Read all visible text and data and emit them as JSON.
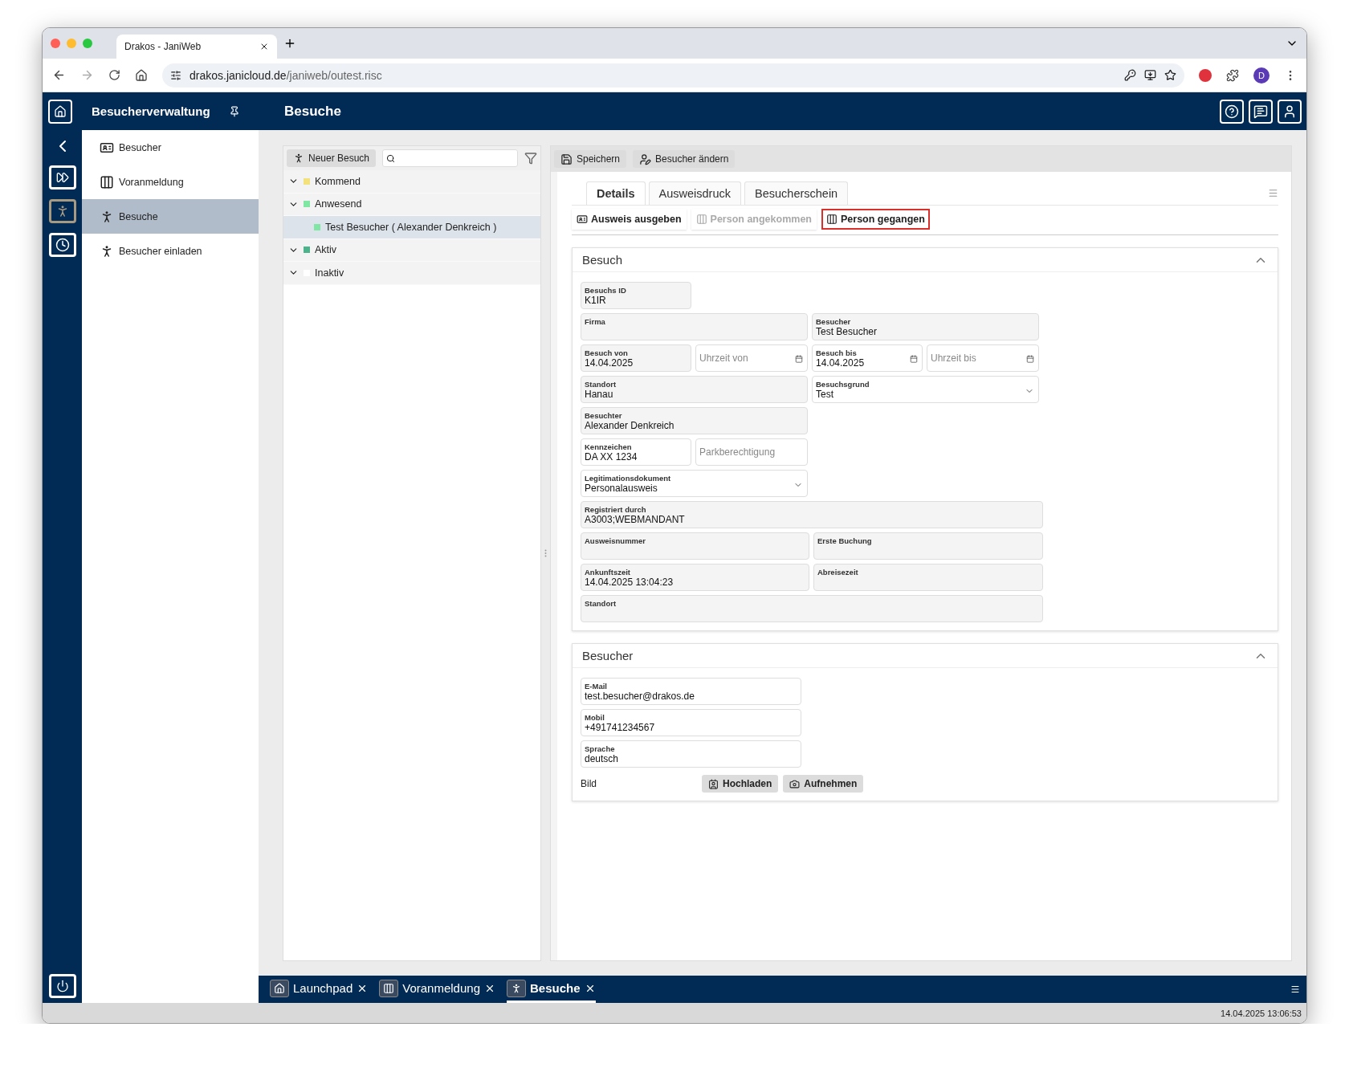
{
  "browser": {
    "tab_title": "Drakos - JaniWeb",
    "url_host": "drakos.janicloud.de",
    "url_path": "/janiweb/outest.risc",
    "profile": "D"
  },
  "header": {
    "module": "Besucherverwaltung",
    "page": "Besuche"
  },
  "sidebar": {
    "items": [
      {
        "label": "Besucher",
        "selected": false,
        "kind": "card"
      },
      {
        "label": "Voranmeldung",
        "selected": false,
        "kind": "list"
      },
      {
        "label": "Besuche",
        "selected": true,
        "kind": "walk"
      },
      {
        "label": "Besucher einladen",
        "selected": false,
        "kind": "walk"
      }
    ]
  },
  "tree": {
    "new_button": "Neuer Besuch",
    "groups": [
      {
        "label": "Kommend",
        "color": "#f2e27e",
        "expanded": true,
        "selected": false
      },
      {
        "label": "Anwesend",
        "color": "#7fe6a4",
        "expanded": true,
        "selected": false,
        "children": [
          {
            "label": "Test Besucher ( Alexander Denkreich )",
            "color": "#7fe6a4",
            "selected": true
          }
        ]
      },
      {
        "label": "Aktiv",
        "color": "#4db38c",
        "expanded": true,
        "selected": false
      },
      {
        "label": "Inaktiv",
        "color": "#ffffff",
        "expanded": true,
        "selected": false
      }
    ]
  },
  "toolbar": [
    {
      "label": "Speichern",
      "kind": "save"
    },
    {
      "label": "Besucher ändern",
      "kind": "edit"
    }
  ],
  "detail_tabs": [
    {
      "label": "Details",
      "selected": true
    },
    {
      "label": "Ausweisdruck",
      "selected": false
    },
    {
      "label": "Besucherschein",
      "selected": false
    }
  ],
  "actions": [
    {
      "label": "Ausweis ausgeben",
      "kind": "card",
      "disabled": false,
      "highlighted": false
    },
    {
      "label": "Person angekommen",
      "kind": "list",
      "disabled": true,
      "highlighted": false
    },
    {
      "label": "Person gegangen",
      "kind": "list",
      "disabled": false,
      "highlighted": true
    }
  ],
  "sections": [
    {
      "title": "Besuch",
      "expanded": true,
      "rows": [
        [
          {
            "label": "Besuchs ID",
            "value": "K1IR",
            "kind": "text",
            "readonly": true
          }
        ],
        [
          {
            "label": "Firma",
            "kind": "text",
            "readonly": true
          },
          {
            "label": "Besucher",
            "value": "Test Besucher",
            "kind": "text",
            "readonly": true
          }
        ],
        [
          {
            "label": "Besuch von",
            "value": "14.04.2025",
            "kind": "text",
            "readonly": true
          },
          {
            "placeholder": "Uhrzeit von",
            "kind": "date",
            "readonly": false
          },
          {
            "label": "Besuch bis",
            "value": "14.04.2025",
            "kind": "date",
            "readonly": false
          },
          {
            "placeholder": "Uhrzeit bis",
            "kind": "date",
            "readonly": false
          }
        ],
        [
          {
            "label": "Standort",
            "value": "Hanau",
            "kind": "text",
            "readonly": true
          },
          {
            "label": "Besuchsgrund",
            "value": "Test",
            "kind": "select",
            "readonly": false
          }
        ],
        [
          {
            "label": "Besuchter",
            "value": "Alexander Denkreich",
            "kind": "text",
            "readonly": true
          }
        ],
        [
          {
            "label": "Kennzeichen",
            "value": "DA XX 1234",
            "kind": "text",
            "readonly": false
          },
          {
            "placeholder": "Parkberechtigung",
            "kind": "text",
            "readonly": false
          }
        ],
        [
          {
            "label": "Legitimationsdokument",
            "value": "Personalausweis",
            "kind": "select",
            "readonly": false
          }
        ],
        [
          {
            "label": "Registriert durch",
            "value": "A3003;WEBMANDANT",
            "kind": "text",
            "readonly": true
          }
        ],
        [
          {
            "label": "Ausweisnummer",
            "kind": "text",
            "readonly": true
          },
          {
            "label": "Erste Buchung",
            "kind": "text",
            "readonly": true
          }
        ],
        [
          {
            "label": "Ankunftszeit",
            "value": "14.04.2025 13:04:23",
            "kind": "text",
            "readonly": true
          },
          {
            "label": "Abreisezeit",
            "kind": "text",
            "readonly": true
          }
        ],
        [
          {
            "label": "Standort",
            "kind": "text",
            "readonly": true
          }
        ]
      ]
    },
    {
      "title": "Besucher",
      "expanded": true,
      "rows": [
        [
          {
            "label": "E-Mail",
            "value": "test.besucher@drakos.de",
            "kind": "text",
            "readonly": false
          }
        ],
        [
          {
            "label": "Mobil",
            "value": "+491741234567",
            "kind": "text",
            "readonly": false
          }
        ],
        [
          {
            "label": "Sprache",
            "value": "deutsch",
            "kind": "text",
            "readonly": false
          }
        ]
      ],
      "image_row": {
        "label": "Bild",
        "buttons": [
          {
            "label": "Hochladen",
            "kind": "upload"
          },
          {
            "label": "Aufnehmen",
            "kind": "camera"
          }
        ]
      }
    }
  ],
  "taskbar": [
    {
      "label": "Launchpad",
      "kind": "home",
      "selected": false
    },
    {
      "label": "Voranmeldung",
      "kind": "list",
      "selected": false
    },
    {
      "label": "Besuche",
      "kind": "walk",
      "selected": true
    }
  ],
  "status_bar": {
    "time": "14.04.2025 13:06:53"
  }
}
